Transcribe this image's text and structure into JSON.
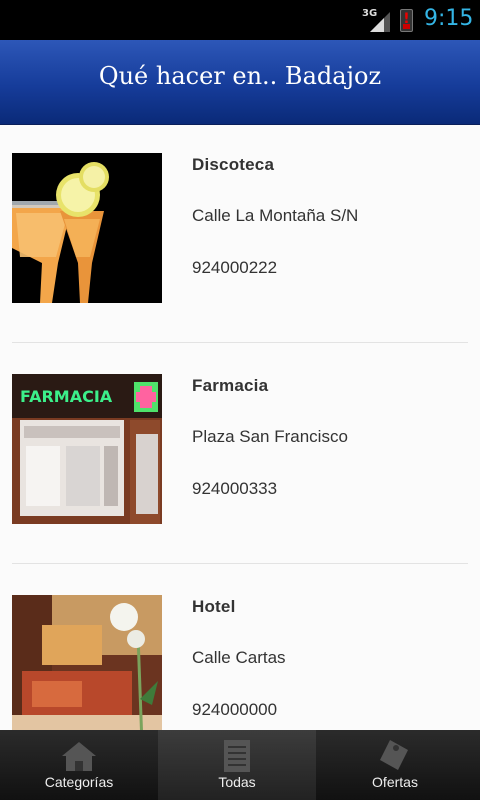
{
  "status_bar": {
    "network": "3G",
    "signal_icon": "signal-icon",
    "battery_icon": "battery-alert-icon",
    "battery_alert": "!",
    "time": "9:15"
  },
  "header": {
    "title": "Qué hacer en.. Badajoz"
  },
  "places": [
    {
      "name": "Discoteca",
      "address": "Calle La Montaña S/N",
      "phone": "924000222",
      "image_icon": "cocktail-image"
    },
    {
      "name": "Farmacia",
      "address": "Plaza San Francisco",
      "phone": "924000333",
      "image_icon": "pharmacy-image",
      "image_sign": "FARMACIA"
    },
    {
      "name": "Hotel",
      "address": "Calle Cartas",
      "phone": "924000000",
      "image_icon": "hotel-room-image"
    }
  ],
  "tabs": [
    {
      "label": "Categorías",
      "icon": "house-icon",
      "active": false
    },
    {
      "label": "Todas",
      "icon": "list-document-icon",
      "active": true
    },
    {
      "label": "Ofertas",
      "icon": "tag-icon",
      "active": false
    }
  ],
  "colors": {
    "header_blue": "#163c9a",
    "clock_blue": "#34b5e5",
    "text": "#333333"
  }
}
